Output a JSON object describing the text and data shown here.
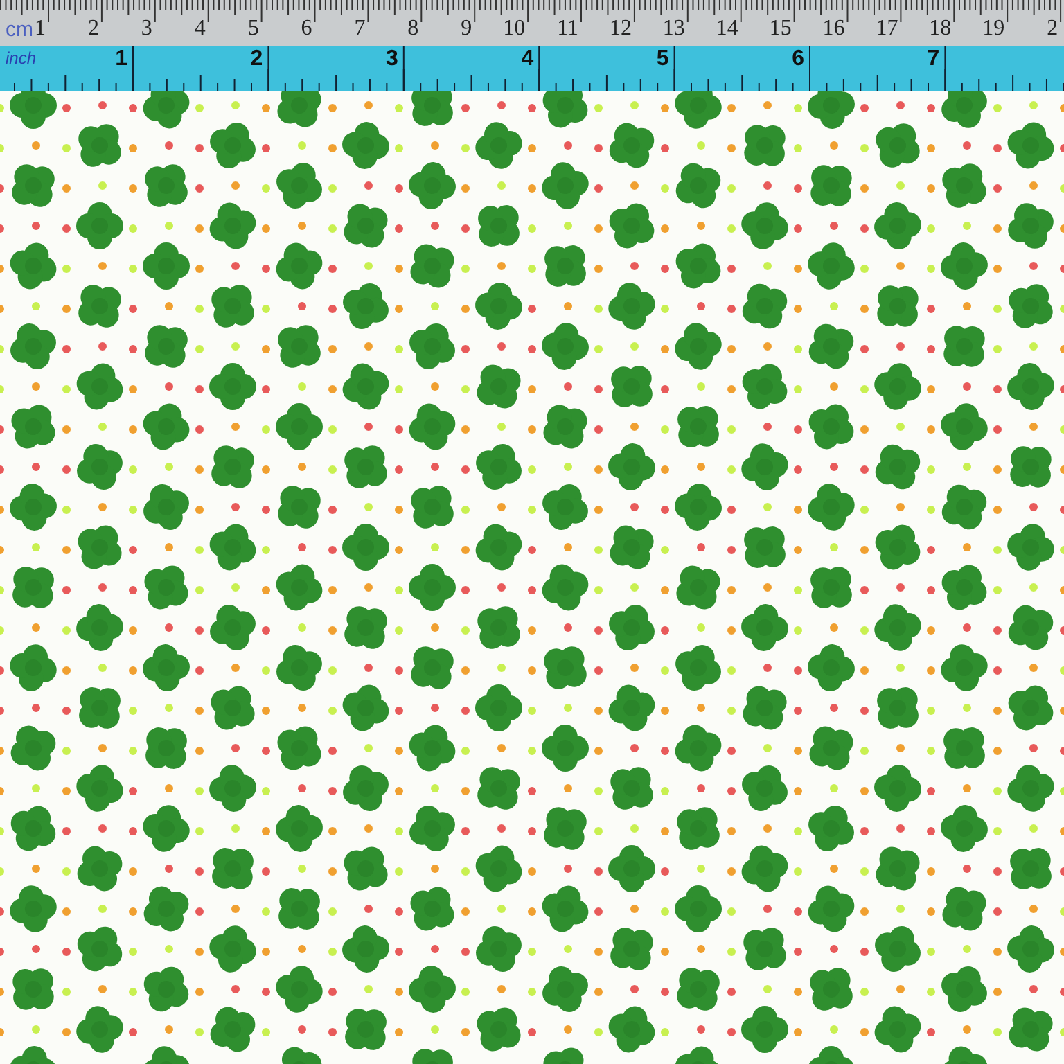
{
  "ruler": {
    "cm_label": "cm",
    "cm_marks": [
      "1",
      "2",
      "3",
      "4",
      "5",
      "6",
      "7",
      "8",
      "9",
      "10",
      "11",
      "12",
      "13",
      "14",
      "15",
      "16",
      "17",
      "18",
      "19",
      "2"
    ],
    "inch_label": "inch",
    "inch_marks": [
      "1",
      "2",
      "3",
      "4",
      "5",
      "6",
      "7"
    ]
  }
}
